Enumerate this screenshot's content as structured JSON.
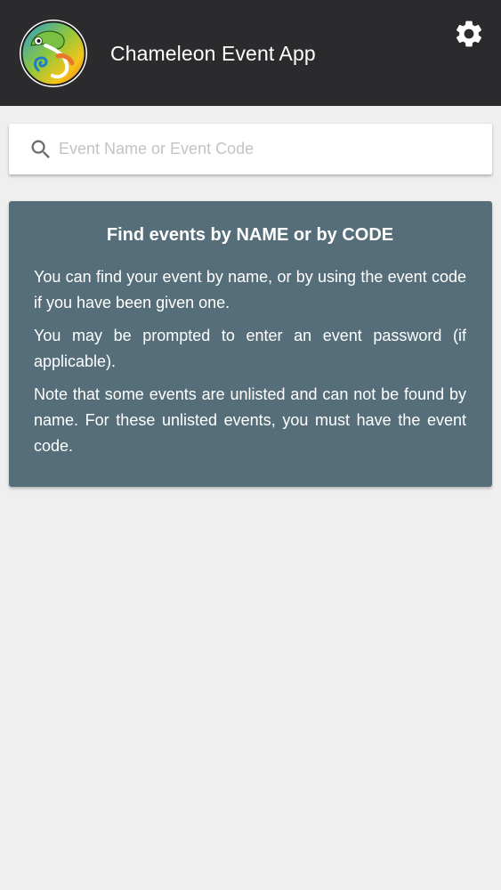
{
  "app_bar": {
    "title": "Chameleon Event App",
    "logo_icon": "chameleon-logo-icon",
    "settings_icon": "gear-icon"
  },
  "search": {
    "placeholder": "Event Name or Event Code",
    "value": "",
    "icon": "search-icon"
  },
  "info_card": {
    "title": "Find events by NAME or by CODE",
    "paragraphs": [
      "You can find your event by name, or by using the event code if you have been given one.",
      "You may be prompted to enter an event password (if applicable).",
      "Note that some events are unlisted and can not be found by name. For these unlisted events, you must have the event code."
    ]
  },
  "colors": {
    "app_bar_bg": "#2b2a2d",
    "page_bg": "#efefef",
    "card_bg": "#566e79",
    "text_light": "#ffffff"
  }
}
